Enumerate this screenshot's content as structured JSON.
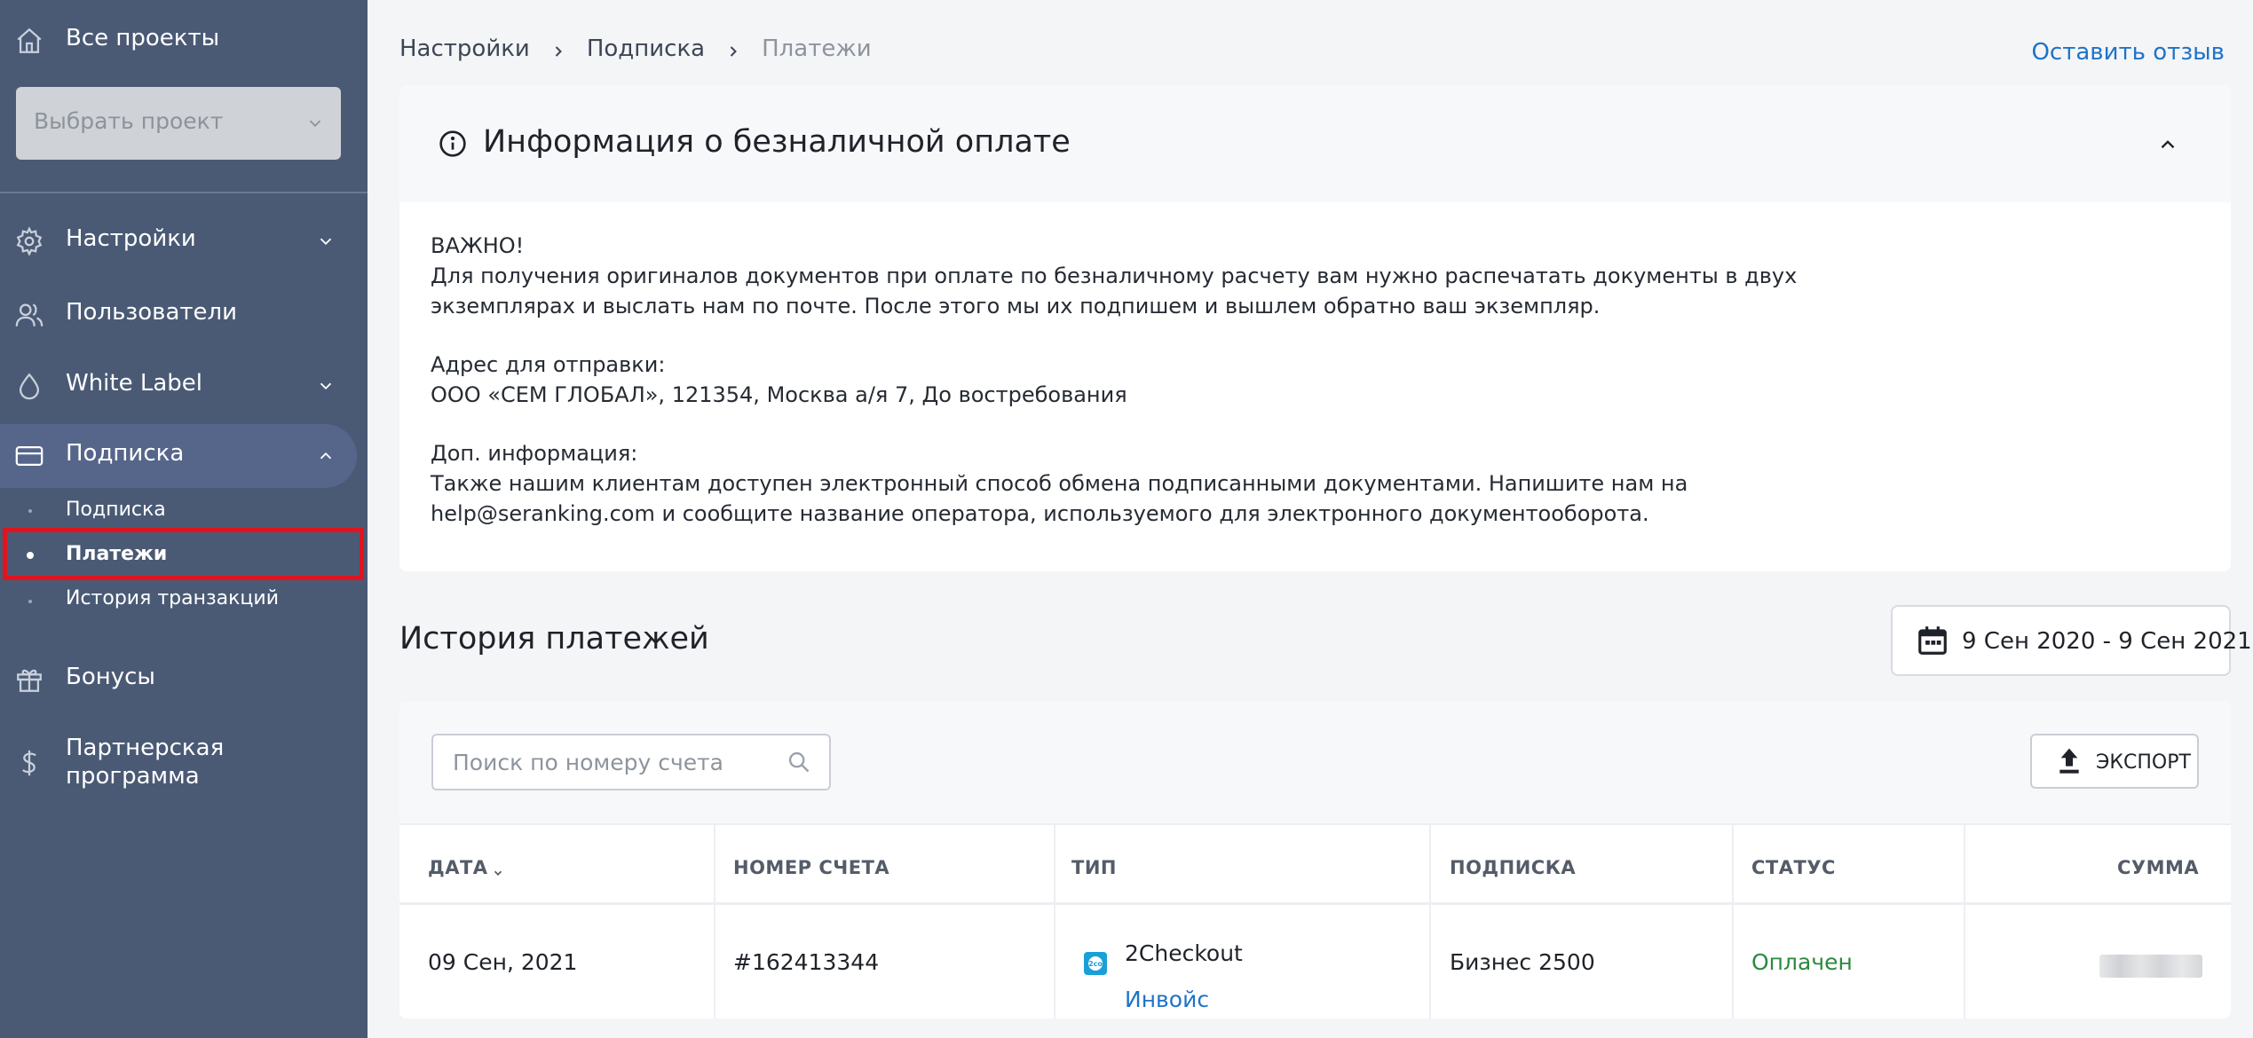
{
  "sidebar": {
    "all_projects": "Все проекты",
    "project_select_placeholder": "Выбрать проект",
    "items": [
      {
        "label": "Настройки",
        "icon": "gear-icon"
      },
      {
        "label": "Пользователи",
        "icon": "users-icon"
      },
      {
        "label": "White Label",
        "icon": "drop-icon"
      },
      {
        "label": "Подписка",
        "icon": "card-icon"
      },
      {
        "label": "Бонусы",
        "icon": "gift-icon"
      },
      {
        "label": "Партнерская программа",
        "icon": "dollar-icon"
      }
    ],
    "partner_line1": "Партнерская",
    "partner_line2": "программа",
    "sub_items": [
      "Подписка",
      "Платежи",
      "История транзакций"
    ],
    "active_sub_item": "Платежи"
  },
  "breadcrumb": [
    "Настройки",
    "Подписка",
    "Платежи"
  ],
  "feedback_link": "Оставить отзыв",
  "info": {
    "title": "Информация о безналичной оплате",
    "important": "ВАЖНО!",
    "line1": "Для получения оригиналов документов при оплате по безналичному расчету вам нужно распечатать документы в двух",
    "line2": "экземплярах и выслать нам по почте. После этого мы их подпишем и вышлем обратно ваш экземпляр.",
    "address_label": "Адрес для отправки:",
    "address": "ООО «СЕМ ГЛОБАЛ», 121354, Москва а/я 7, До востребования",
    "extra_label": "Доп. информация:",
    "extra_line1": "Также нашим клиентам доступен электронный способ обмена подписанными документами. Напишите нам на",
    "extra_line2": "help@seranking.com и сообщите название оператора, используемого для электронного документооборота."
  },
  "history": {
    "title": "История платежей",
    "date_range": "9 Сен 2020 - 9 Сен 2021",
    "search_placeholder": "Поиск по номеру счета",
    "export_label": "ЭКСПОРТ",
    "columns": [
      "ДАТА",
      "НОМЕР СЧЕТА",
      "ТИП",
      "ПОДПИСКА",
      "СТАТУС",
      "СУММА"
    ],
    "rows": [
      {
        "date": "09 Сен, 2021",
        "invoice": "#162413344",
        "type": "2Checkout",
        "type_link": "Инвойс",
        "subscription": "Бизнес 2500",
        "status": "Оплачен"
      }
    ]
  },
  "colors": {
    "sidebar_bg": "#4a5a75",
    "link": "#1e73c8",
    "status_paid": "#2b8a3e",
    "highlight": "#e0141e"
  }
}
